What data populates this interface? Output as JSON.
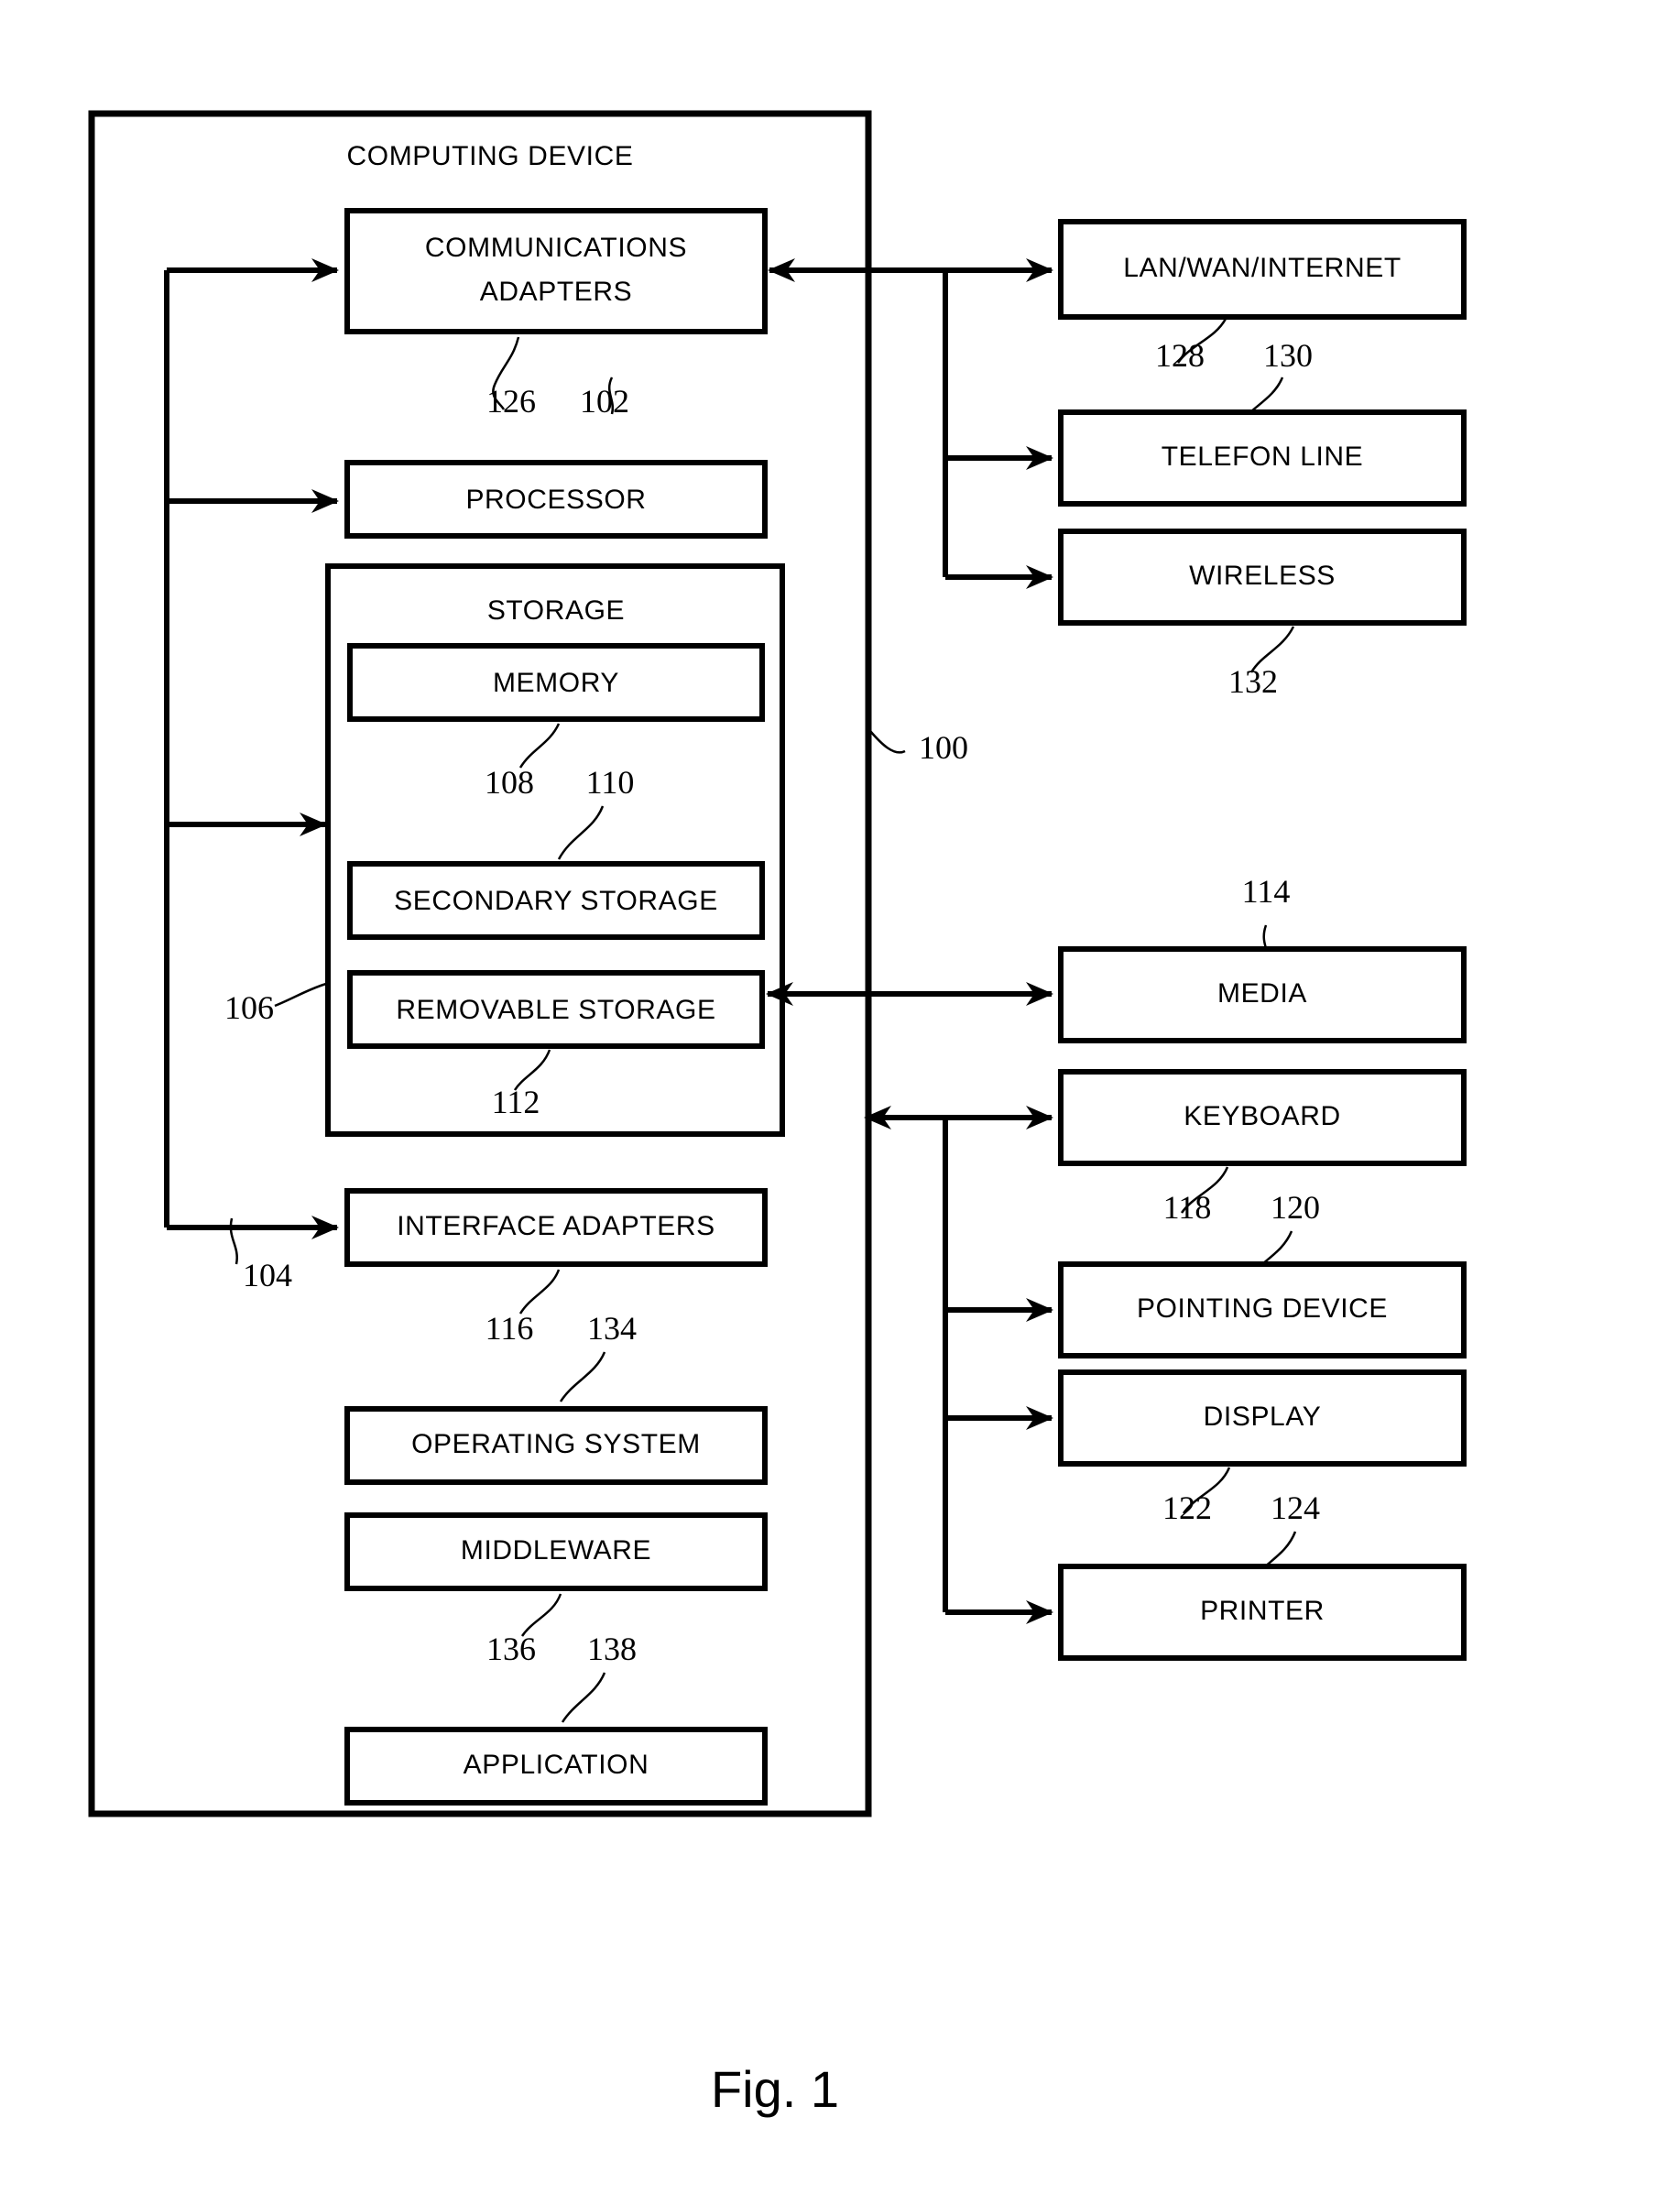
{
  "figure": {
    "caption": "Fig. 1",
    "system_label": "COMPUTING DEVICE",
    "system_ref": "100"
  },
  "computing_device": {
    "title": "COMPUTING DEVICE",
    "blocks": [
      {
        "id": "communications-adapters",
        "label_line1": "COMMUNICATIONS",
        "label_line2": "ADAPTERS",
        "ref": "102"
      },
      {
        "id": "processor",
        "label": "PROCESSOR",
        "ref": "104"
      },
      {
        "id": "storage",
        "label": "STORAGE",
        "ref": "106"
      },
      {
        "id": "memory",
        "label": "MEMORY",
        "ref": "108"
      },
      {
        "id": "secondary-storage",
        "label": "SECONDARY STORAGE",
        "ref": "110"
      },
      {
        "id": "removable-storage",
        "label": "REMOVABLE STORAGE",
        "ref": "112"
      },
      {
        "id": "interface-adapters",
        "label": "INTERFACE ADAPTERS",
        "ref": "116"
      },
      {
        "id": "operating-system",
        "label": "OPERATING SYSTEM",
        "ref": "134"
      },
      {
        "id": "middleware",
        "label": "MIDDLEWARE",
        "ref": "136"
      },
      {
        "id": "application",
        "label": "APPLICATION",
        "ref": "138"
      }
    ]
  },
  "external": {
    "blocks": [
      {
        "id": "lan-wan-internet",
        "label": "LAN/WAN/INTERNET",
        "ref": "128"
      },
      {
        "id": "telefon-line",
        "label": "TELEFON LINE",
        "ref": "130"
      },
      {
        "id": "wireless",
        "label": "WIRELESS",
        "ref": "132"
      },
      {
        "id": "media",
        "label": "MEDIA",
        "ref": "114"
      },
      {
        "id": "keyboard",
        "label": "KEYBOARD",
        "ref": "118"
      },
      {
        "id": "pointing-device",
        "label": "POINTING DEVICE",
        "ref": "120"
      },
      {
        "id": "display",
        "label": "DISPLAY",
        "ref": "122"
      },
      {
        "id": "printer",
        "label": "PRINTER",
        "ref": "124"
      }
    ]
  },
  "reference_numbers": {
    "bus_126": "126",
    "comm_102": "102",
    "proc_104": "104",
    "storage_106": "106",
    "memory_108": "108",
    "secondary_110": "110",
    "removable_112": "112",
    "media_114": "114",
    "iface_116": "116",
    "keyboard_118": "118",
    "pointing_120": "120",
    "display_122": "122",
    "printer_124": "124",
    "lan_128": "128",
    "telefon_130": "130",
    "wireless_132": "132",
    "os_134": "134",
    "middleware_136": "136",
    "application_138": "138",
    "device_100": "100"
  },
  "colors": {
    "ink": "#000000",
    "paper": "#ffffff"
  }
}
